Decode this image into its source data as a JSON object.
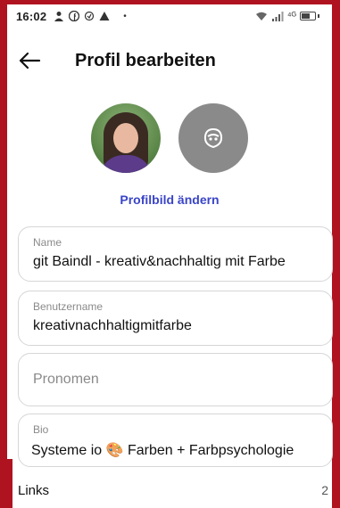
{
  "status_bar": {
    "time": "16:02",
    "left_icons": [
      "person-icon",
      "facebook-icon",
      "sync-icon",
      "warning-icon"
    ],
    "dot": "•",
    "signal_text": "⁴ᴳ"
  },
  "header": {
    "back_icon": "back-arrow-icon",
    "title": "Profil bearbeiten"
  },
  "avatars": {
    "photo_alt": "profile-photo",
    "avatar_icon": "avatar-face-icon"
  },
  "change_photo_label": "Profilbild ändern",
  "fields": {
    "name": {
      "label": "Name",
      "value": "git Baindl - kreativ&nachhaltig mit Farbe"
    },
    "username": {
      "label": "Benutzername",
      "value": "kreativnachhaltigmitfarbe"
    },
    "pronouns": {
      "placeholder": "Pronomen"
    },
    "bio": {
      "label": "Bio",
      "value": "Systeme io 🎨 Farben + Farbpsychologie"
    }
  },
  "links": {
    "label": "Links",
    "count": "2"
  },
  "colors": {
    "frame": "#b01320",
    "accent_link": "#3a45c8",
    "avatar_gray": "#8a8a8a"
  }
}
